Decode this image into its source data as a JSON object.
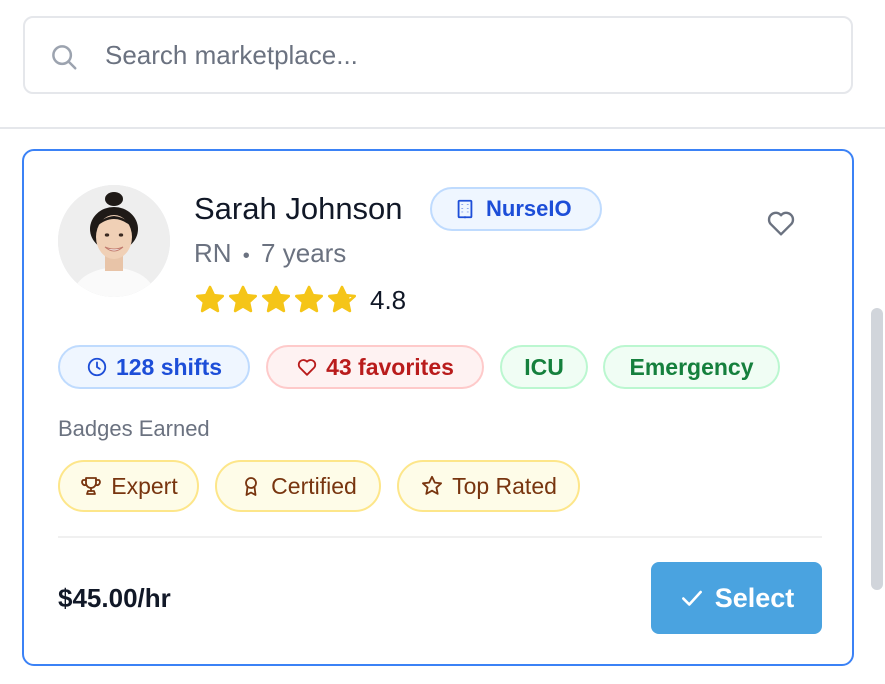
{
  "search": {
    "placeholder": "Search marketplace...",
    "value": "",
    "icon": "search-icon"
  },
  "card": {
    "selected": true,
    "accent_color": "#3b82f6",
    "name": "Sarah Johnson",
    "agency": {
      "label": "NurseIO",
      "icon": "building-icon"
    },
    "favorite_icon": "heart-outline-icon",
    "role": "RN",
    "separator": "•",
    "experience": "7 years",
    "rating": {
      "value": 4.8,
      "label": "4.8",
      "max": 5,
      "star_color": "#f5c518"
    },
    "tags": [
      {
        "label": "128 shifts",
        "icon": "clock-icon",
        "style": "blue"
      },
      {
        "label": "43 favorites",
        "icon": "heart-outline-icon",
        "style": "red"
      },
      {
        "label": "ICU",
        "style": "green"
      },
      {
        "label": "Emergency",
        "style": "green"
      }
    ],
    "badges_label": "Badges Earned",
    "badges": [
      {
        "label": "Expert",
        "icon": "trophy-icon"
      },
      {
        "label": "Certified",
        "icon": "award-ribbon-icon"
      },
      {
        "label": "Top Rated",
        "icon": "star-outline-icon"
      }
    ],
    "price": "$45.00/hr",
    "select_button": {
      "label": "Select",
      "icon": "check-icon",
      "color": "#4aa3e0"
    }
  }
}
